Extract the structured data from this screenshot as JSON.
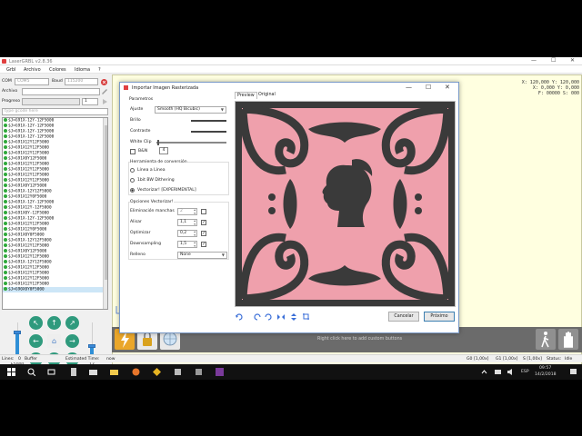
{
  "window": {
    "title": "LaserGRBL v2.8.36",
    "controls": {
      "min": "—",
      "max": "☐",
      "close": "✕"
    }
  },
  "menu": [
    "Grbl",
    "Archivo",
    "Colores",
    "Idioma",
    "?"
  ],
  "left": {
    "com_label": "COM",
    "com_value": "COM5",
    "baud_label": "Baud",
    "baud_value": "115200",
    "file_label": "Archivo",
    "file_value": "",
    "progress_label": "Progreso",
    "progress_value": "1",
    "command_placeholder": "type gcode here",
    "commands": [
      "$J=G91X-12Y-12F5000",
      "$J=G91X-12Y-12F5000",
      "$J=G91X-12Y-12F5000",
      "$J=G91X-12Y-12F5000",
      "$J=G91X12Y12F5000",
      "$J=G91X12Y12F5000",
      "$J=G91X12Y12F5000",
      "$J=G91X0Y12F5000",
      "$J=G91X12Y12F5000",
      "$J=G91X12Y12F5000",
      "$J=G91X12Y12F5000",
      "$J=G91X12Y12F5000",
      "$J=G91X0Y12F5000",
      "$J=G91X-12Y12F5000",
      "$J=G91X12Y0F5000",
      "$J=G91X-12Y-12F5000",
      "$J=G91X12Y-12F5000",
      "$J=G91X0Y-12F5000",
      "$J=G91X-12Y-12F5000",
      "$J=G91X12Y12F5000",
      "$J=G91X12Y0F5000",
      "$J=G91X0Y0F5000",
      "$J=G91X-12Y12F5000",
      "$J=G91X12Y12F5000",
      "$J=G91X0Y12F5000",
      "$J=G91X12Y12F5000",
      "$J=G91X-12Y12F5000",
      "$J=G91X12Y12F5000",
      "$J=G91X12Y12F5000",
      "$J=G91X12Y12F5000",
      "$J=G91X12Y12F5000",
      "$J=G90X0Y0F5000"
    ],
    "jog": {
      "nw": "↖",
      "n": "↑",
      "ne": "↗",
      "w": "←",
      "home": "⌂",
      "e": "→",
      "sw": "↙",
      "s": "↓",
      "se": "↘"
    },
    "feed_value": "F5000",
    "step_value": "12",
    "feed_level": 0.72,
    "step_level": 0.35
  },
  "canvas": {
    "coords": [
      "X: 120,000 Y: 120,000",
      "X: 0,000 Y: 0,000",
      "F: 00000 S: 000"
    ],
    "hint": "Right click here to add custom buttons"
  },
  "status": {
    "lines_label": "Lines:",
    "lines_value": "0",
    "buffer_label": "Buffer",
    "est_label": "Estimated Time:",
    "est_value": "now",
    "g0": "G0 [1,00x]",
    "g1": "G1 [1,00x]",
    "s": "S [1,00x]",
    "status_label": "Status:",
    "status_value": "Idle"
  },
  "taskbar": {
    "lang": "ESP",
    "time": "09:57",
    "date": "14/2/2018"
  },
  "dialog": {
    "title": "Importar Imagen Rasterizada",
    "params_title": "Parametros",
    "adjust_label": "Ajuste",
    "adjust_value": "Smooth (HQ Bicubic)",
    "brightness_label": "Brillo",
    "contrast_label": "Contraste",
    "whiteclip_label": "White Clip",
    "tooltip": "4",
    "bw_label": "B&N",
    "tool_title": "Herramienta de conversión",
    "modes": [
      "Línea a Línea",
      "1bit BW Dithering",
      "Vectorizar! [EXPERIMENTAL]"
    ],
    "vector_title": "Opciones Vectorizar!",
    "spot_label": "Eliminación manchas",
    "spot_value": "2",
    "smooth_label": "Alisar",
    "smooth_value": "1,1",
    "optimize_label": "Optimizar",
    "optimize_value": "0,2",
    "downsample_label": "Downsampling",
    "downsample_value": "1,5",
    "fill_label": "Relleno",
    "fill_value": "None",
    "tab_preview": "Preview",
    "tab_original": "Original",
    "cancel": "Cancelar",
    "next": "Próximo"
  }
}
